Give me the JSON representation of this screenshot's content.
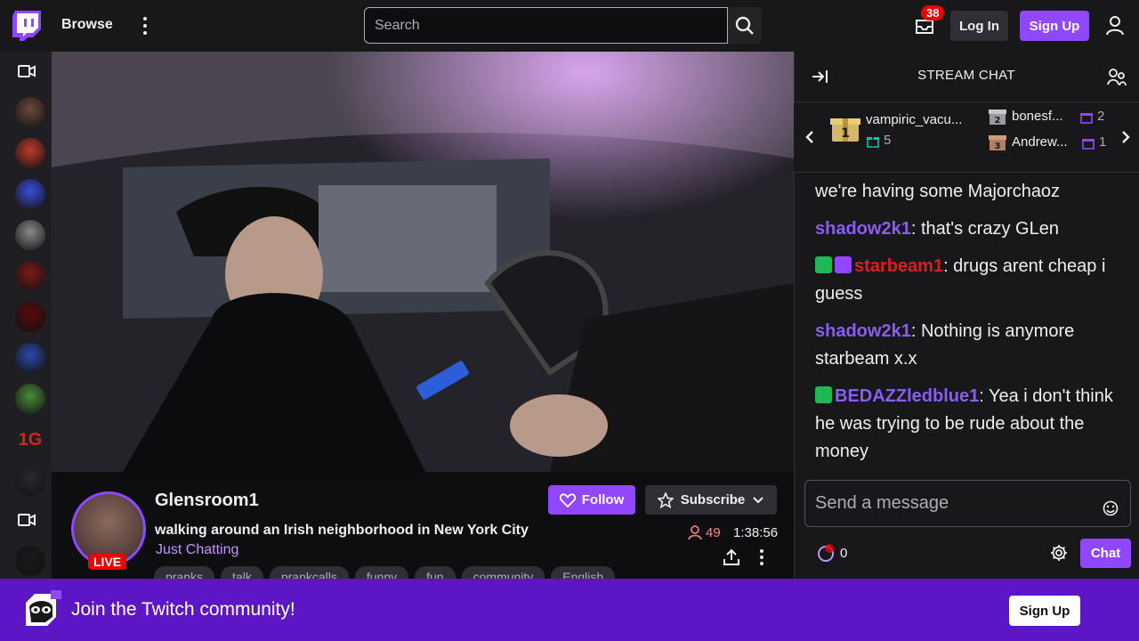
{
  "nav": {
    "browse_label": "Browse",
    "search_placeholder": "Search",
    "inbox_count": "38",
    "login_label": "Log In",
    "signup_label": "Sign Up"
  },
  "sidebar": {
    "avatars": [
      {
        "color": "#6b4a3a"
      },
      {
        "color": "#c0392b"
      },
      {
        "color": "#3a4fd8"
      },
      {
        "color": "#8a8a8a"
      },
      {
        "color": "#7a1a1a"
      },
      {
        "color": "#5a0a0a"
      },
      {
        "color": "#2a4aa8"
      },
      {
        "color": "#4a8a3a"
      },
      {
        "text": "1G",
        "color": "#d0241b"
      },
      {
        "color": "#2a2a30"
      },
      {
        "color": "#1a1a1a"
      }
    ]
  },
  "stream": {
    "channel": "Glensroom1",
    "title": "walking around an Irish neighborhood in New York City",
    "category": "Just Chatting",
    "live_label": "LIVE",
    "follow_label": "Follow",
    "subscribe_label": "Subscribe",
    "viewers": "49",
    "uptime": "1:38:56",
    "tags": [
      "pranks",
      "talk",
      "prankcalls",
      "funny",
      "fun",
      "community",
      "English"
    ]
  },
  "chat": {
    "header": "STREAM CHAT",
    "gifters": [
      {
        "rank": "1",
        "name": "vampiric_vacu...",
        "count": "5"
      },
      {
        "rank": "2",
        "name": "bonesf...",
        "count": "2"
      },
      {
        "rank": "3",
        "name": "Andrew...",
        "count": "1"
      }
    ],
    "messages": [
      {
        "user": "",
        "text": "we're having some Majorchaoz",
        "color": "#efeff1"
      },
      {
        "user": "shadow2k1",
        "text": ": that's crazy GLen",
        "color": "#8a5cf6"
      },
      {
        "user": "starbeam1",
        "text": ": drugs arent cheap i guess",
        "color": "#e01d1d",
        "badges": [
          "#1db954",
          "#9147ff"
        ]
      },
      {
        "user": "shadow2k1",
        "text": ": Nothing is anymore starbeam x.x",
        "color": "#8a5cf6"
      },
      {
        "user": "BEDAZZledblue1",
        "text": ": Yea i don't think he was trying to be rude about the money",
        "color": "#8a5cf6",
        "badges": [
          "#1db954"
        ]
      }
    ],
    "input_placeholder": "Send a message",
    "points": "0",
    "chat_label": "Chat"
  },
  "banner": {
    "text": "Join the Twitch community!",
    "signup_label": "Sign Up"
  },
  "colors": {
    "accent": "#9147ff",
    "banner": "#5c16c5",
    "live": "#eb0400"
  }
}
